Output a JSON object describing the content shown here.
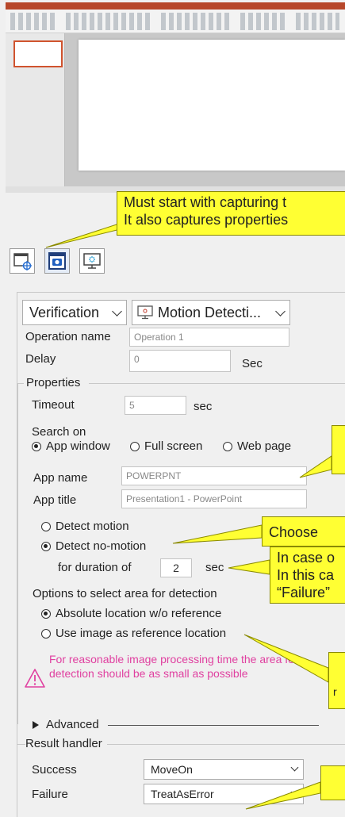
{
  "toolbar": {
    "buttons": [
      {
        "icon": "window-target-icon"
      },
      {
        "icon": "camera-icon"
      },
      {
        "icon": "monitor-motion-icon"
      }
    ]
  },
  "operation": {
    "type_value": "Verification",
    "kind_value": "Motion Detecti..."
  },
  "general": {
    "operation_name_label": "Operation name",
    "operation_name_value": "Operation 1",
    "delay_label": "Delay",
    "delay_value": "0",
    "delay_unit": "Sec"
  },
  "properties": {
    "title": "Properties",
    "timeout_label": "Timeout",
    "timeout_value": "5",
    "timeout_unit": "sec",
    "search_on_label": "Search on",
    "search_options": [
      "App window",
      "Full screen",
      "Web page"
    ],
    "search_selected": "App window",
    "app_name_label": "App name",
    "app_name_value": "POWERPNT",
    "app_title_label": "App title",
    "app_title_value": "Presentation1 - PowerPoint",
    "detect_motion_label": "Detect motion",
    "detect_nomotion_label": "Detect no-motion",
    "detect_selected": "Detect no-motion",
    "duration_label": "for duration of",
    "duration_value": "2",
    "duration_unit": "sec",
    "area_options_label": "Options to select area for detection",
    "area_absolute_label": "Absolute location w/o reference",
    "area_image_label": "Use image as reference location",
    "warning_text": "For reasonable image processing time the area for detection should be as small as possible",
    "advanced_label": "Advanced"
  },
  "result_handler": {
    "title": "Result handler",
    "success_label": "Success",
    "success_value": "MoveOn",
    "failure_label": "Failure",
    "failure_value": "TreatAsError"
  },
  "callouts": {
    "capture_line1": "Must start with capturing t",
    "capture_line2": "It also captures properties",
    "choose": "Choose",
    "case_line1": "In case o",
    "case_line2": "In this ca",
    "case_line3": "“Failure”",
    "r": "r"
  },
  "colors": {
    "callout": "#ffff33",
    "warning": "#e040a0",
    "ppt_accent": "#b7472a"
  }
}
